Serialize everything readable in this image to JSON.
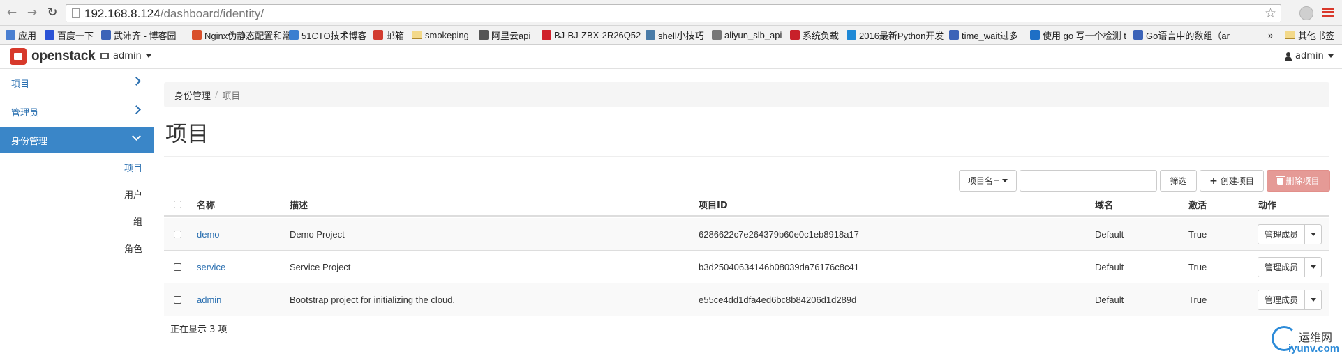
{
  "browser": {
    "url_host": "192.168.8.124",
    "url_path": "/dashboard/identity/",
    "bookmarks": [
      {
        "label": "应用",
        "icon": "apps-grid-icon",
        "color": "#4a7fd1"
      },
      {
        "label": "百度一下",
        "icon": "baidu-paw-icon",
        "color": "#2b53d6"
      },
      {
        "label": "武沛齐 - 博客园",
        "icon": "blog-icon",
        "color": "#3c63b8"
      },
      {
        "label": "Nginx伪静态配置和常",
        "icon": "bookmark-j-icon",
        "color": "#d9502b"
      },
      {
        "label": "51CTO技术博客",
        "icon": "51cto-icon",
        "color": "#3b7fd0"
      },
      {
        "label": "邮箱",
        "icon": "mail-icon",
        "color": "#d23b2f"
      },
      {
        "label": "smokeping",
        "icon": "folder-icon",
        "color": "#f3d98a"
      },
      {
        "label": "阿里云api",
        "icon": "aliyun-icon",
        "color": "#555555"
      },
      {
        "label": "BJ-BJ-ZBX-2R26Q52",
        "icon": "zabbix-z-icon",
        "color": "#d0202a"
      },
      {
        "label": "shell小技巧",
        "icon": "shell-icon",
        "color": "#4a7ca8"
      },
      {
        "label": "aliyun_slb_api",
        "icon": "page-icon",
        "color": "#777777"
      },
      {
        "label": "系统负载",
        "icon": "c-icon",
        "color": "#c8202a"
      },
      {
        "label": "2016最新Python开发",
        "icon": "python-icon",
        "color": "#1e88d6"
      },
      {
        "label": "time_wait过多",
        "icon": "blog-icon",
        "color": "#3c63b8"
      },
      {
        "label": "使用 go 写一个检测 t",
        "icon": "60-icon",
        "color": "#1e6fc6"
      },
      {
        "label": "Go语言中的数组（ar",
        "icon": "blog-icon",
        "color": "#3c63b8"
      },
      {
        "label": "»",
        "icon": "more-chevron-icon",
        "color": "#333333"
      },
      {
        "label": "其他书签",
        "icon": "folder-icon",
        "color": "#f3d98a"
      }
    ]
  },
  "topbar": {
    "brand": "openstack",
    "project": "admin",
    "user": "admin"
  },
  "sidebar": {
    "items": [
      {
        "label": "项目",
        "active": false
      },
      {
        "label": "管理员",
        "active": false
      },
      {
        "label": "身份管理",
        "active": true
      }
    ],
    "sub_items": [
      {
        "label": "项目",
        "current": true
      },
      {
        "label": "用户",
        "current": false
      },
      {
        "label": "组",
        "current": false
      },
      {
        "label": "角色",
        "current": false
      }
    ]
  },
  "breadcrumb": {
    "parent": "身份管理",
    "separator": "/",
    "current": "项目"
  },
  "page": {
    "title": "项目"
  },
  "toolbar": {
    "filter_field": "项目名=",
    "filter_value": "",
    "filter_button": "筛选",
    "create_button": "创建项目",
    "delete_button": "删除项目"
  },
  "table": {
    "columns": [
      "名称",
      "描述",
      "项目ID",
      "域名",
      "激活",
      "动作"
    ],
    "rows": [
      {
        "name": "demo",
        "description": "Demo Project",
        "id": "6286622c7e264379b60e0c1eb8918a17",
        "domain": "Default",
        "enabled": "True",
        "action": "管理成员"
      },
      {
        "name": "service",
        "description": "Service Project",
        "id": "b3d25040634146b08039da76176c8c41",
        "domain": "Default",
        "enabled": "True",
        "action": "管理成员"
      },
      {
        "name": "admin",
        "description": "Bootstrap project for initializing the cloud.",
        "id": "e55ce4dd1dfa4ed6bc8b84206d1d289d",
        "domain": "Default",
        "enabled": "True",
        "action": "管理成员"
      }
    ],
    "footer": "正在显示 3 项"
  },
  "watermark": {
    "cn": "运维网",
    "en": "iyunv.com"
  }
}
